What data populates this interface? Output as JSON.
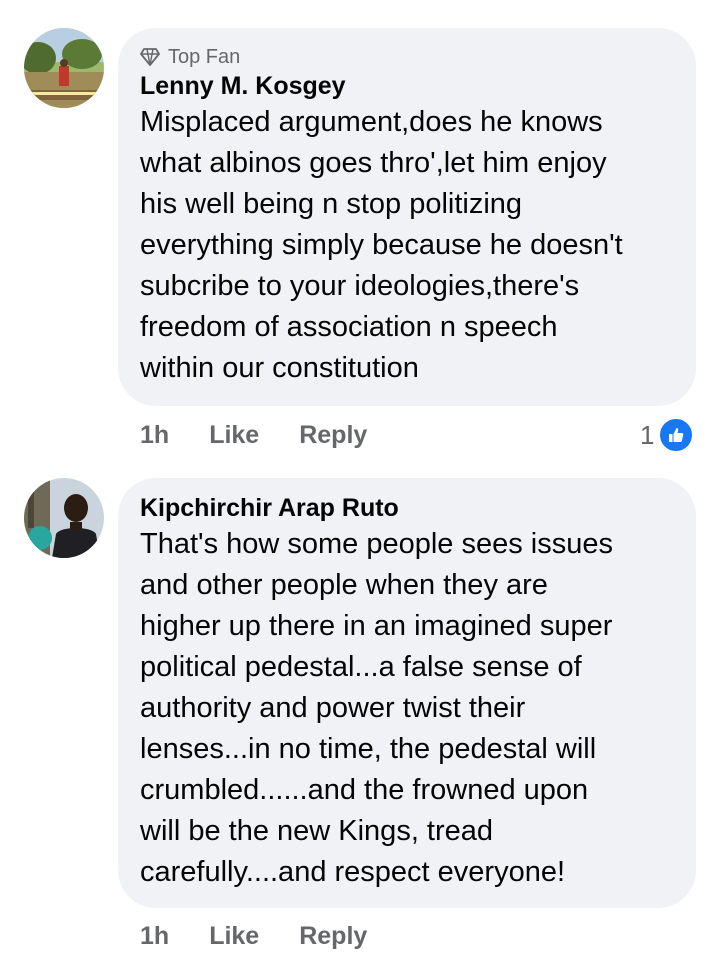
{
  "comments": [
    {
      "badge": "Top Fan",
      "badge_icon": "diamond-icon",
      "author": "Lenny M. Kosgey",
      "text": "Misplaced argument,does he knows\nwhat albinos goes thro',let him enjoy\nhis well being n stop politizing\neverything simply because he doesn't\nsubcribe to your ideologies,there's\nfreedom of association n speech\nwithin our constitution",
      "time": "1h",
      "like_label": "Like",
      "reply_label": "Reply",
      "reaction_count": "1",
      "reaction_icon": "thumbs-up-icon"
    },
    {
      "author": "Kipchirchir Arap Ruto",
      "text": "That's how some people sees issues\nand other people when they are\nhigher up there in an imagined super\npolitical pedestal...a false sense of\nauthority and power twist their\nlenses...in no time, the pedestal will\ncrumbled......and the frowned upon\nwill be the new Kings, tread\ncarefully....and respect everyone!",
      "time": "1h",
      "like_label": "Like",
      "reply_label": "Reply"
    }
  ],
  "colors": {
    "bubble": "#f0f2f5",
    "meta": "#65676b",
    "like_blue": "#1877f2"
  }
}
